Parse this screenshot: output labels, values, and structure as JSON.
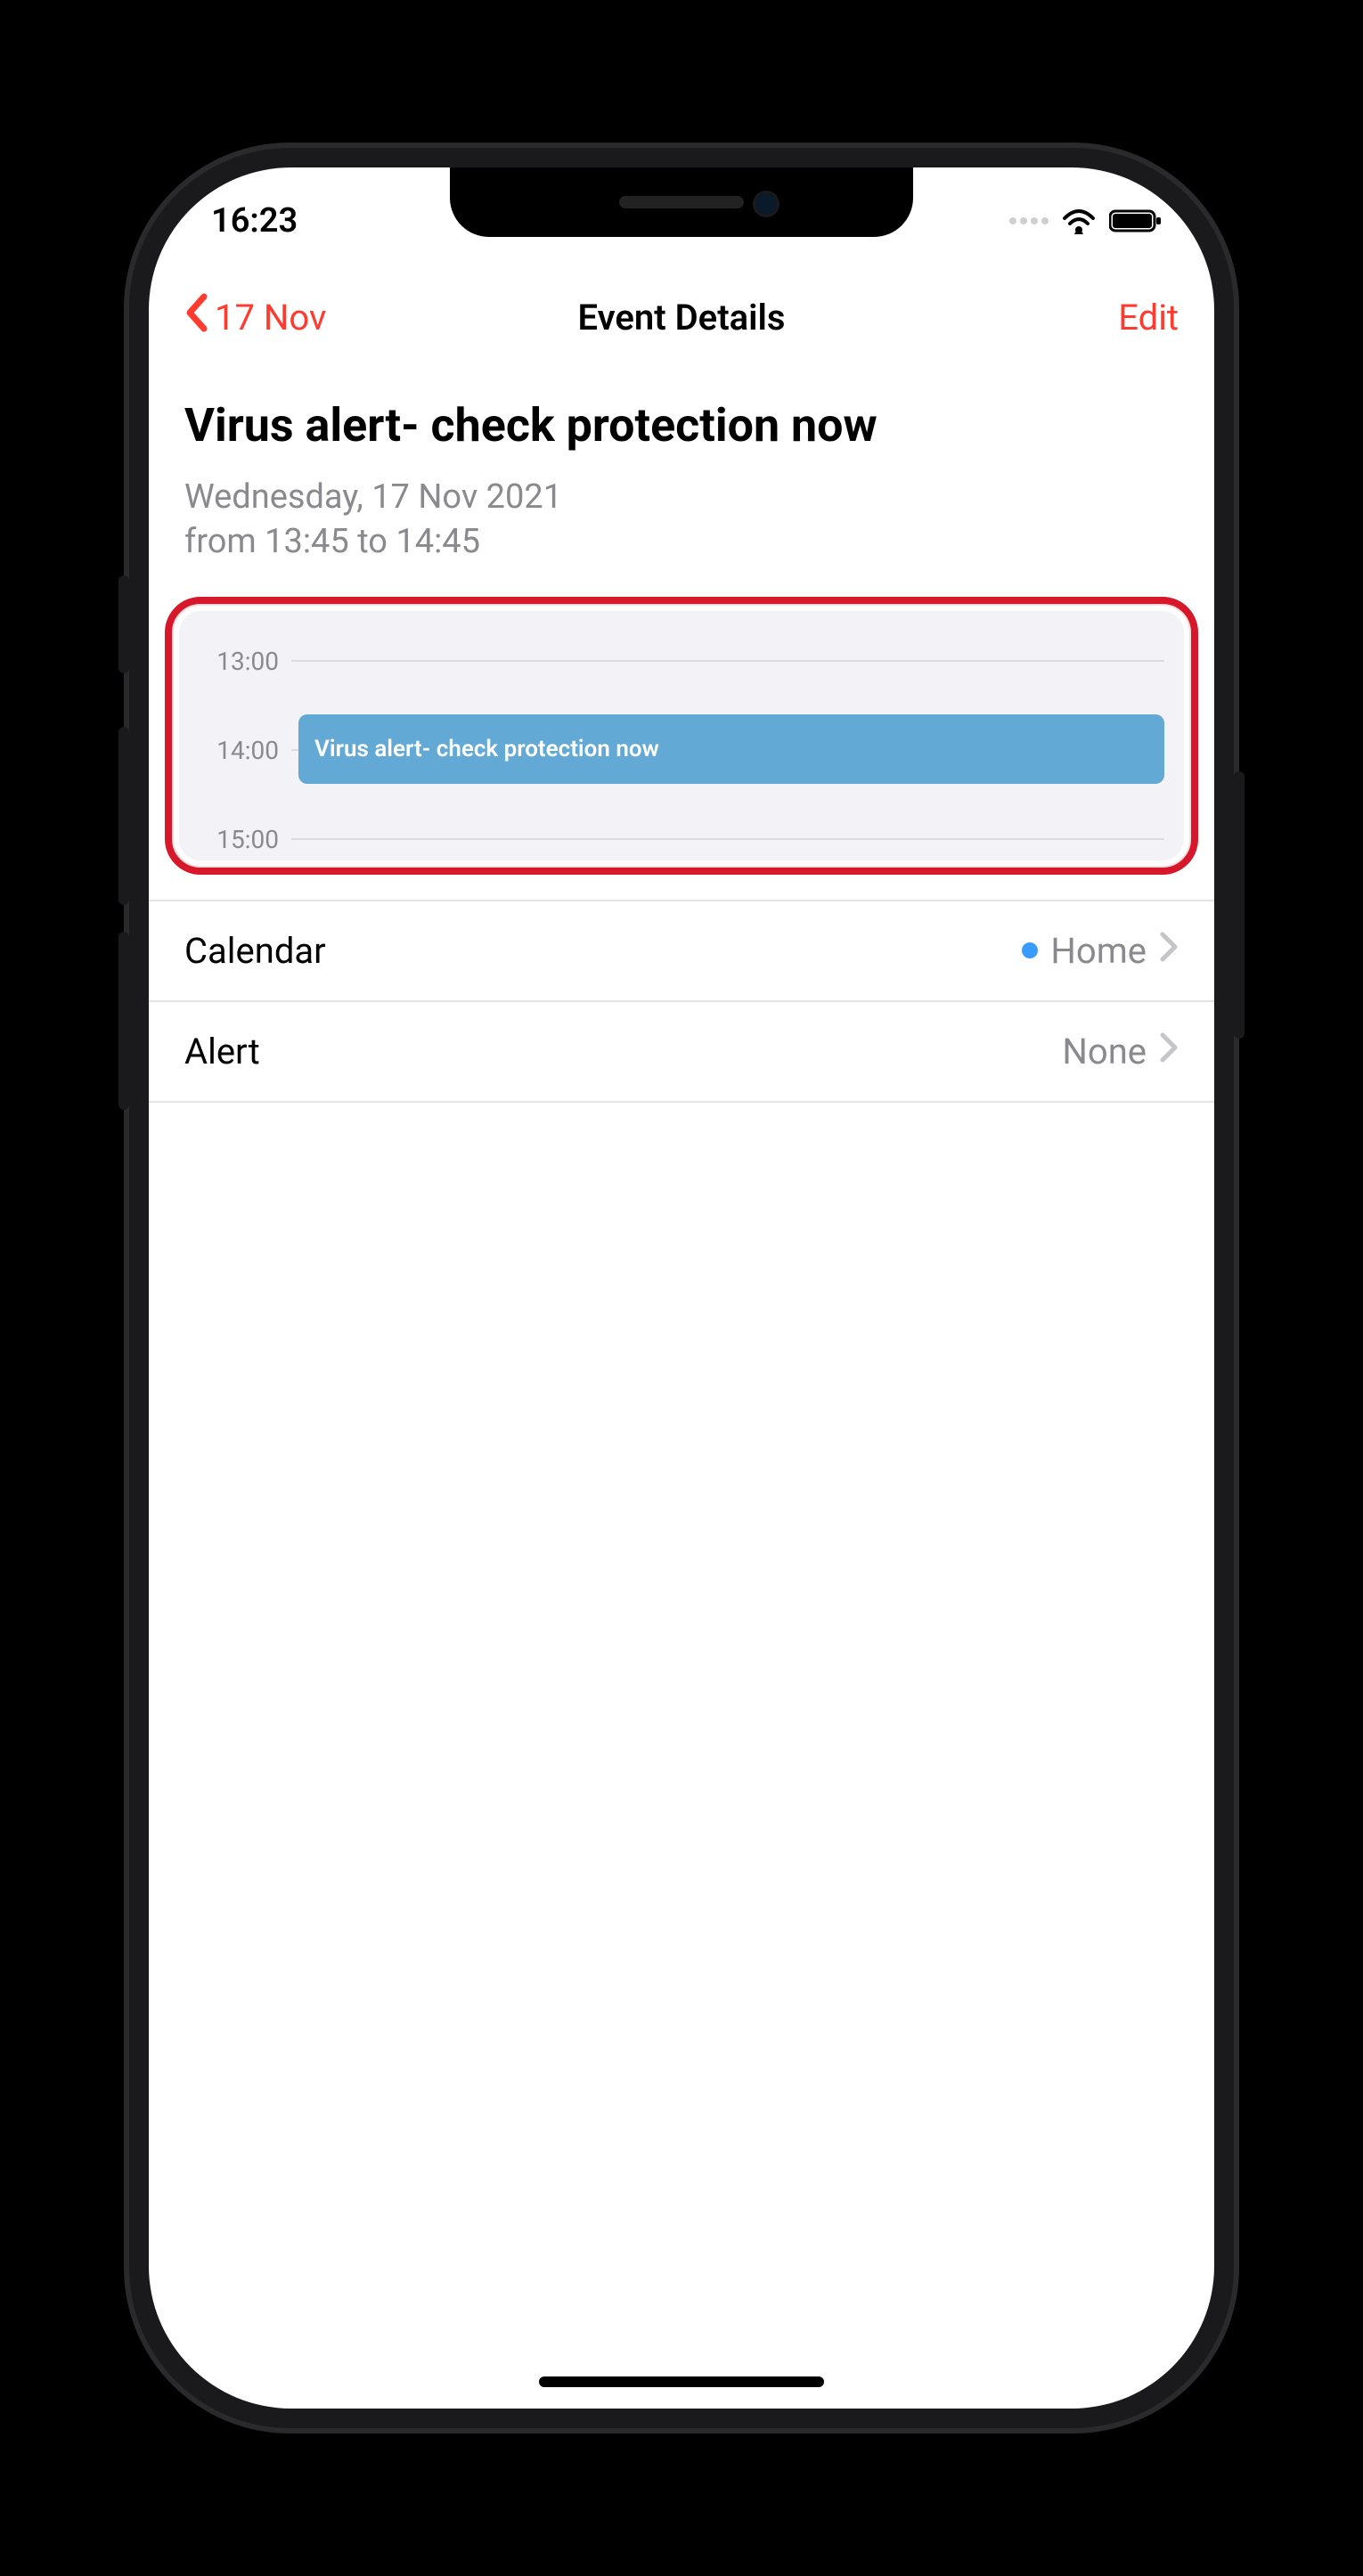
{
  "status": {
    "time": "16:23"
  },
  "nav": {
    "back_label": "17 Nov",
    "title": "Event Details",
    "edit_label": "Edit"
  },
  "event": {
    "title": "Virus alert- check protection now",
    "date_line": "Wednesday, 17 Nov 2021",
    "time_line": "from 13:45 to 14:45"
  },
  "timeline": {
    "hours": [
      "13:00",
      "14:00",
      "15:00"
    ],
    "block_label": "Virus alert- check protection now"
  },
  "rows": {
    "calendar": {
      "label": "Calendar",
      "value": "Home"
    },
    "alert": {
      "label": "Alert",
      "value": "None"
    }
  }
}
